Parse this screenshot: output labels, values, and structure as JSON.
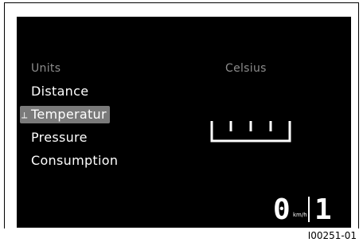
{
  "menu": {
    "title": "Units",
    "items": [
      {
        "label": "Distance"
      },
      {
        "label": "Temperatur",
        "selected": true
      },
      {
        "label": "Pressure"
      },
      {
        "label": "Consumption"
      }
    ],
    "selection_icon": "arrow-selector-icon"
  },
  "detail": {
    "value": "Celsius",
    "scale_icon": "thermometer-scale-icon"
  },
  "status": {
    "speed": "0",
    "speed_unit": "km/h",
    "gear": "1"
  },
  "figure_id": "I00251-01",
  "colors": {
    "screen_background": "#000000",
    "text_primary": "#ffffff",
    "text_muted": "#8c8c8c",
    "selection_highlight": "#7a7a7a"
  }
}
